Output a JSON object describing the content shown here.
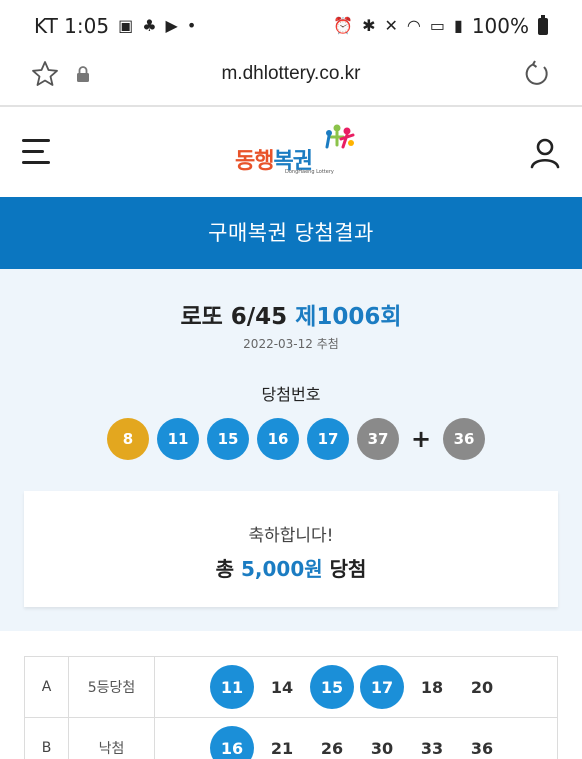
{
  "status_bar": {
    "carrier_time": "KT 1:05",
    "battery": "100%"
  },
  "browser": {
    "url": "m.dhlottery.co.kr"
  },
  "header": {
    "logo_text_a": "동행",
    "logo_text_b": "복권",
    "logo_sub": "DongHaeng Lottery"
  },
  "page_title": "구매복권 당첨결과",
  "draw": {
    "game": "로또 6/45",
    "round": "제1006회",
    "date": "2022-03-12 추첨",
    "win_label": "당첨번호",
    "numbers": [
      {
        "n": "8",
        "color": "#e3a71f"
      },
      {
        "n": "11",
        "color": "#1b8fd8"
      },
      {
        "n": "15",
        "color": "#1b8fd8"
      },
      {
        "n": "16",
        "color": "#1b8fd8"
      },
      {
        "n": "17",
        "color": "#1b8fd8"
      },
      {
        "n": "37",
        "color": "#8a8a8a"
      }
    ],
    "plus": "+",
    "bonus": {
      "n": "36",
      "color": "#8a8a8a"
    }
  },
  "congrats": {
    "message": "축하합니다!",
    "prefix": "총 ",
    "amount": "5,000원",
    "suffix": " 당첨"
  },
  "ticket_rows": [
    {
      "letter": "A",
      "result": "5등당첨",
      "numbers": [
        {
          "n": "11",
          "hit": true
        },
        {
          "n": "14",
          "hit": false
        },
        {
          "n": "15",
          "hit": true
        },
        {
          "n": "17",
          "hit": true
        },
        {
          "n": "18",
          "hit": false
        },
        {
          "n": "20",
          "hit": false
        }
      ]
    },
    {
      "letter": "B",
      "result": "낙첨",
      "numbers": [
        {
          "n": "16",
          "hit": true
        },
        {
          "n": "21",
          "hit": false
        },
        {
          "n": "26",
          "hit": false
        },
        {
          "n": "30",
          "hit": false
        },
        {
          "n": "33",
          "hit": false
        },
        {
          "n": "36",
          "hit": false
        }
      ]
    }
  ]
}
